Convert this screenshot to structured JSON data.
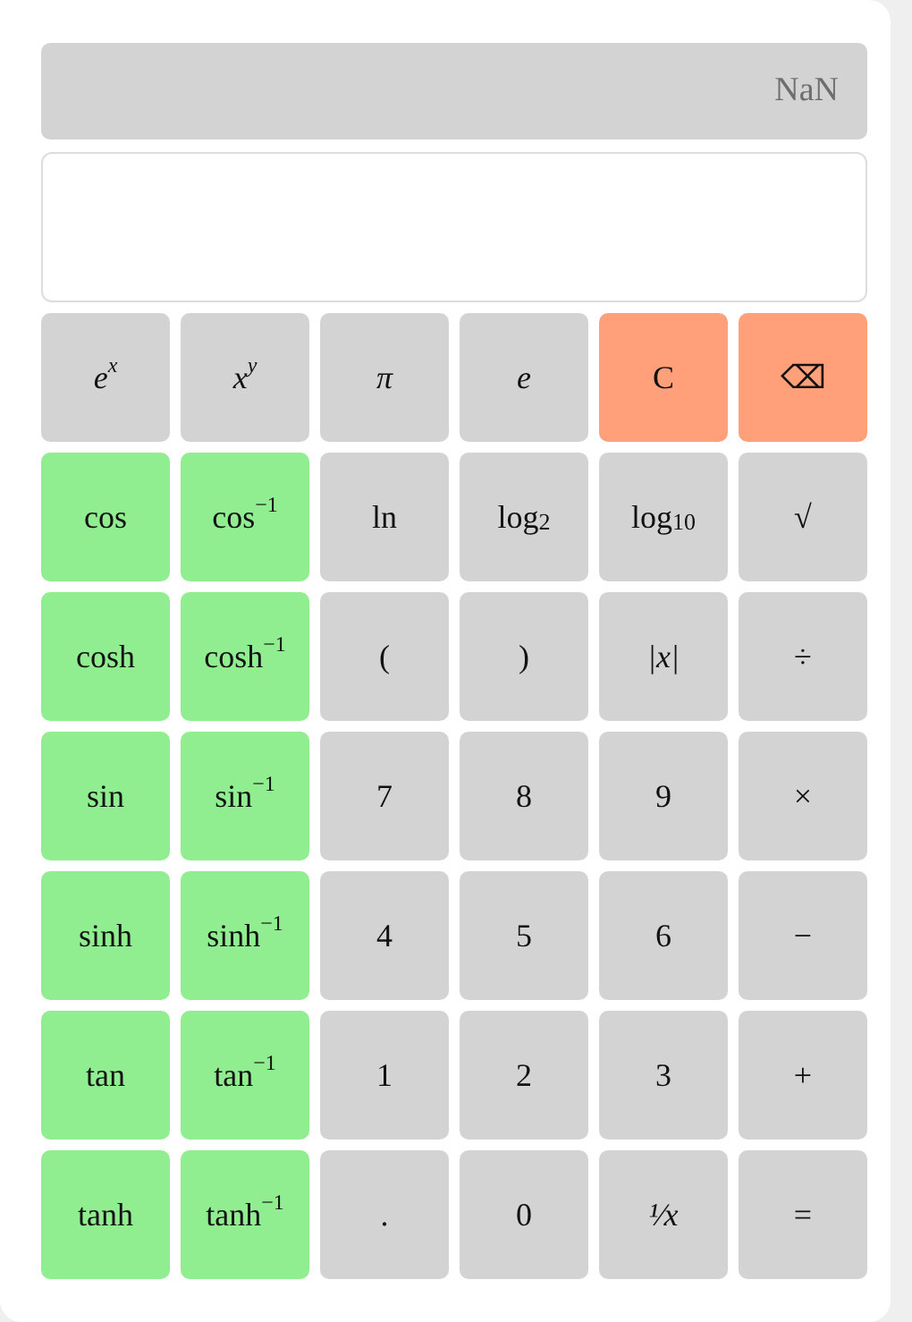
{
  "display": {
    "value": "NaN"
  },
  "keys": [
    [
      {
        "label": "e$^{x}$",
        "kind": "math"
      },
      {
        "label": "x$^{y}$",
        "kind": "math"
      },
      {
        "label": "π",
        "kind": "math"
      },
      {
        "label": "e",
        "kind": "math"
      },
      {
        "label": "C",
        "kind": "clear"
      },
      {
        "label": "⌫",
        "kind": "clear"
      }
    ],
    [
      {
        "label": "cos",
        "kind": "fn"
      },
      {
        "label": "cos$^{−1}$",
        "kind": "fn"
      },
      {
        "label": "ln",
        "kind": "key"
      },
      {
        "label": "log$_{2}$",
        "kind": "key"
      },
      {
        "label": "log$_{10}$",
        "kind": "key"
      },
      {
        "label": "√",
        "kind": "key"
      }
    ],
    [
      {
        "label": "cosh",
        "kind": "fn"
      },
      {
        "label": "cosh$^{−1}$",
        "kind": "fn"
      },
      {
        "label": "(",
        "kind": "key"
      },
      {
        "label": ")",
        "kind": "key"
      },
      {
        "label": "|x|",
        "kind": "math"
      },
      {
        "label": "÷",
        "kind": "key"
      }
    ],
    [
      {
        "label": "sin",
        "kind": "fn"
      },
      {
        "label": "sin$^{−1}$",
        "kind": "fn"
      },
      {
        "label": "7",
        "kind": "key"
      },
      {
        "label": "8",
        "kind": "key"
      },
      {
        "label": "9",
        "kind": "key"
      },
      {
        "label": "×",
        "kind": "key"
      }
    ],
    [
      {
        "label": "sinh",
        "kind": "fn"
      },
      {
        "label": "sinh$^{−1}$",
        "kind": "fn"
      },
      {
        "label": "4",
        "kind": "key"
      },
      {
        "label": "5",
        "kind": "key"
      },
      {
        "label": "6",
        "kind": "key"
      },
      {
        "label": "−",
        "kind": "key"
      }
    ],
    [
      {
        "label": "tan",
        "kind": "fn"
      },
      {
        "label": "tan$^{−1}$",
        "kind": "fn"
      },
      {
        "label": "1",
        "kind": "key"
      },
      {
        "label": "2",
        "kind": "key"
      },
      {
        "label": "3",
        "kind": "key"
      },
      {
        "label": "+",
        "kind": "key"
      }
    ],
    [
      {
        "label": "tanh",
        "kind": "fn"
      },
      {
        "label": "tanh$^{−1}$",
        "kind": "fn"
      },
      {
        "label": ".",
        "kind": "key"
      },
      {
        "label": "0",
        "kind": "key"
      },
      {
        "label": "¹⁄x",
        "kind": "math"
      },
      {
        "label": "=",
        "kind": "key"
      }
    ]
  ]
}
